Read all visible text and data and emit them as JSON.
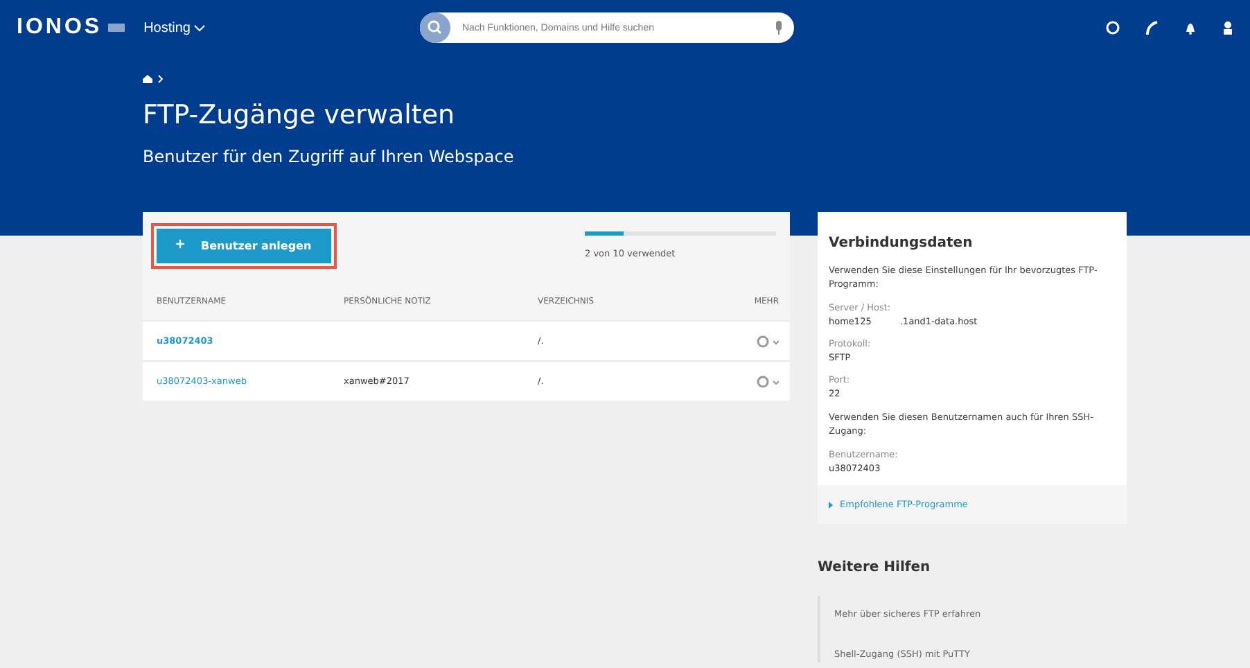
{
  "topbar": {
    "logo": "IONOS",
    "menu": "Hosting",
    "search": {
      "placeholder": "Nach Funktionen, Domains und Hilfe suchen"
    }
  },
  "header": {
    "title": "FTP-Zugänge verwalten",
    "subtitle": "Benutzer für den Zugriff auf Ihren Webspace"
  },
  "users": {
    "add_button": "Benutzer anlegen",
    "usage": {
      "level": 0.2,
      "text": "2 von 10 verwendet"
    },
    "columns": [
      "BENUTZERNAME",
      "PERSÖNLICHE NOTIZ",
      "VERZEICHNIS",
      "MEHR"
    ],
    "rows": [
      {
        "username": "u38072403",
        "bold": true,
        "note": "",
        "directory": "/."
      },
      {
        "username": "u38072403-xanweb",
        "bold": false,
        "note": "xanweb#2017",
        "directory": "/."
      }
    ]
  },
  "connection": {
    "title": "Verbindungsdaten",
    "intro": "Verwenden Sie diese Einstellungen für Ihr bevorzugtes FTP-Programm:",
    "fields": [
      {
        "label": "Server / Host:",
        "value": "home125          .1and1-data.host"
      },
      {
        "label": "Protokoll:",
        "value": "SFTP"
      },
      {
        "label": "Port:",
        "value": "22"
      }
    ],
    "ssh_note": "Verwenden Sie diesen Benutzernamen auch für Ihren SSH-Zugang:",
    "user_field": {
      "label": "Benutzername:",
      "value": "u38072403"
    },
    "link": "Empfohlene FTP-Programme"
  },
  "help": {
    "title": "Weitere Hilfen",
    "items": [
      "Mehr über sicheres FTP erfahren",
      "Shell-Zugang (SSH) mit PuTTY"
    ]
  }
}
